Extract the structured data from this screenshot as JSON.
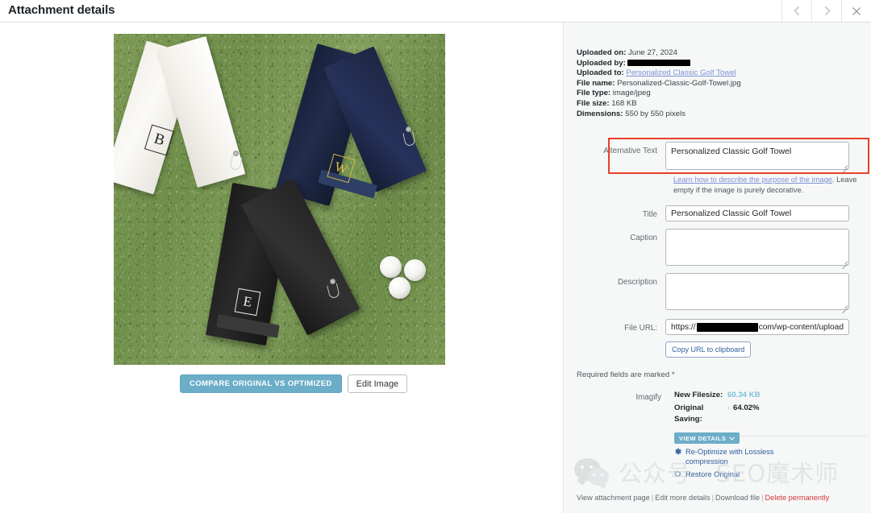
{
  "header": {
    "title": "Attachment details",
    "prev_icon": "chevron-left-icon",
    "next_icon": "chevron-right-icon",
    "close_icon": "close-icon"
  },
  "media": {
    "image_alt": "Personalized Classic Golf Towel",
    "monograms": [
      "B",
      "W",
      "E"
    ],
    "compare_button": "COMPARE ORIGINAL VS OPTIMIZED",
    "edit_button": "Edit Image"
  },
  "meta": {
    "uploaded_on_label": "Uploaded on:",
    "uploaded_on_value": "June 27, 2024",
    "uploaded_by_label": "Uploaded by:",
    "uploaded_by_value": "",
    "uploaded_to_label": "Uploaded to:",
    "uploaded_to_value": "Personalized Classic Golf Towel",
    "file_name_label": "File name:",
    "file_name_value": "Personalized-Classic-Golf-Towel.jpg",
    "file_type_label": "File type:",
    "file_type_value": "image/jpeg",
    "file_size_label": "File size:",
    "file_size_value": "168 KB",
    "dimensions_label": "Dimensions:",
    "dimensions_value": "550 by 550 pixels"
  },
  "fields": {
    "alt_text_label": "Alternative Text",
    "alt_text_value": "Personalized Classic Golf Towel",
    "alt_help_link": "Learn how to describe the purpose of the image",
    "alt_help_rest": ". Leave empty if the image is purely decorative.",
    "title_label": "Title",
    "title_value": "Personalized Classic Golf Towel",
    "caption_label": "Caption",
    "caption_value": "",
    "description_label": "Description",
    "description_value": "",
    "file_url_label": "File URL:",
    "file_url_prefix": "https://",
    "file_url_suffix": "com/wp-content/upload",
    "copy_button": "Copy URL to clipboard"
  },
  "required_note": "Required fields are marked *",
  "imagify": {
    "label": "Imagify",
    "new_filesize_label": "New Filesize:",
    "new_filesize_value": "60.34 KB",
    "original_saving_label": "Original Saving:",
    "original_saving_value": "64.02%",
    "view_details_button": "VIEW DETAILS",
    "reoptimize_action": "Re-Optimize with Lossless compression",
    "reoptimize_icon": "gear-icon",
    "restore_action": "Restore Original",
    "restore_icon": "restore-arrow-icon"
  },
  "footer": {
    "view_attachment_page": "View attachment page",
    "edit_more_details": "Edit more details",
    "download_file": "Download file",
    "delete_permanently": "Delete permanently",
    "separator": "|"
  },
  "watermark": {
    "text": "公众号 · SEO魔术师",
    "logo_icon": "wechat-icon"
  },
  "colors": {
    "accent_blue": "#6cadc8",
    "link_blue": "#2c5f9e",
    "meta_link": "#7f92d6",
    "highlight_red": "#e8402a",
    "danger_red": "#d63638",
    "panel_bg": "#f6f7f7"
  }
}
